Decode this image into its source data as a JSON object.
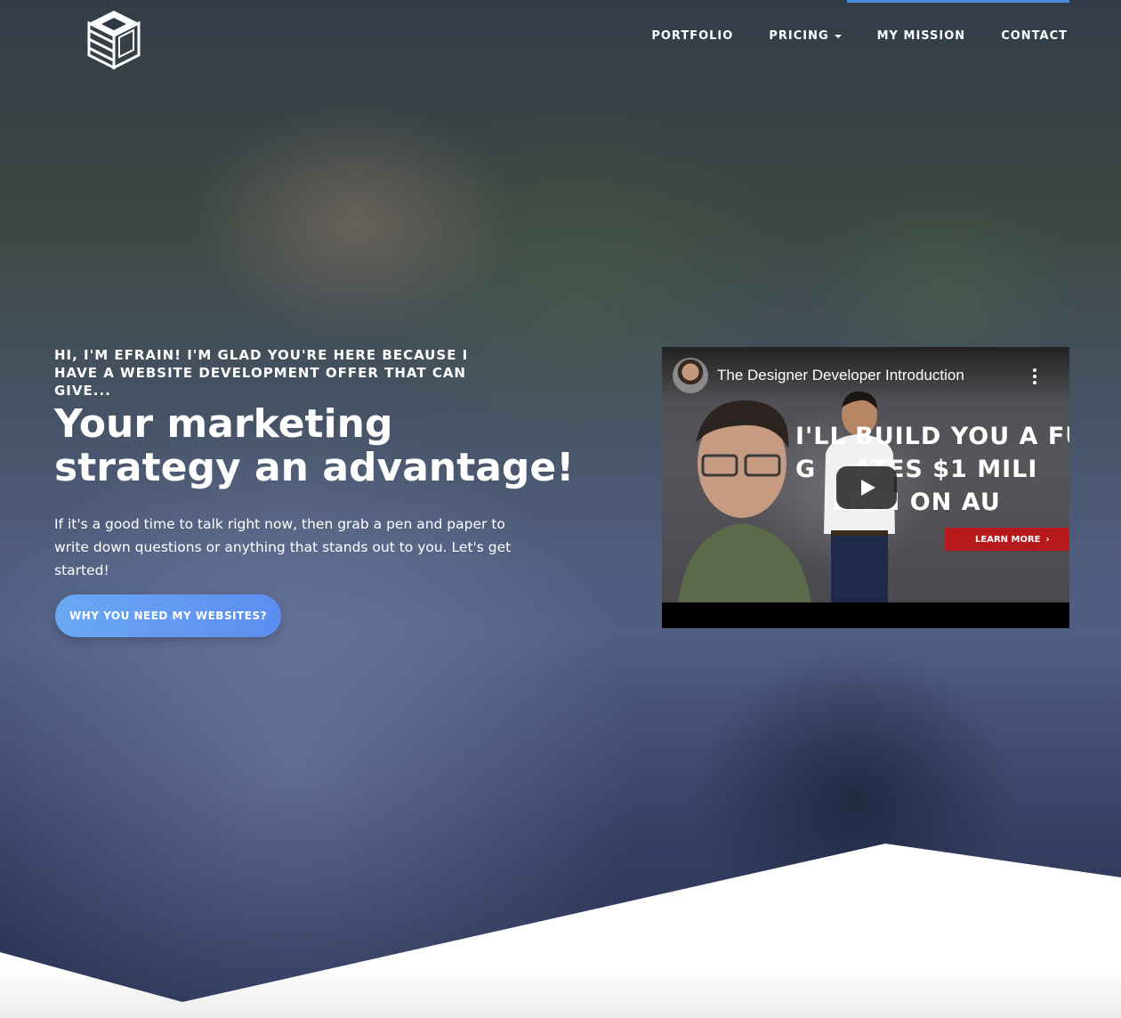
{
  "nav": {
    "items": [
      {
        "label": "PORTFOLIO"
      },
      {
        "label": "PRICING",
        "has_dropdown": true
      },
      {
        "label": "MY MISSION"
      },
      {
        "label": "CONTACT"
      }
    ]
  },
  "hero": {
    "eyebrow": "HI, I'M EFRAIN! I'M GLAD YOU'RE HERE BECAUSE I HAVE A WEBSITE DEVELOPMENT OFFER THAT CAN GIVE...",
    "headline": "Your marketing strategy an advantage!",
    "lead": "If it's a good time to talk right now, then grab a pen and paper to write down questions or anything that stands out to you. Let's get started!",
    "cta_label": "WHY YOU NEED MY WEBSITES?"
  },
  "video": {
    "title": "The Designer Developer Introduction",
    "thumb_lines": [
      "I'LL BUILD YOU A FU",
      "G    ATES $1 MILI",
      "    LION ON AU"
    ],
    "learn_more": "LEARN MORE"
  },
  "colors": {
    "accent": "#4a90e2",
    "cta_start": "#6aa8f3",
    "cta_end": "#5c8df0",
    "youtube_red": "#b8191c"
  },
  "icons": {
    "logo": "isometric-cube-logo",
    "play": "play-icon",
    "more": "kebab-menu-icon",
    "dropdown": "caret-down-icon"
  }
}
